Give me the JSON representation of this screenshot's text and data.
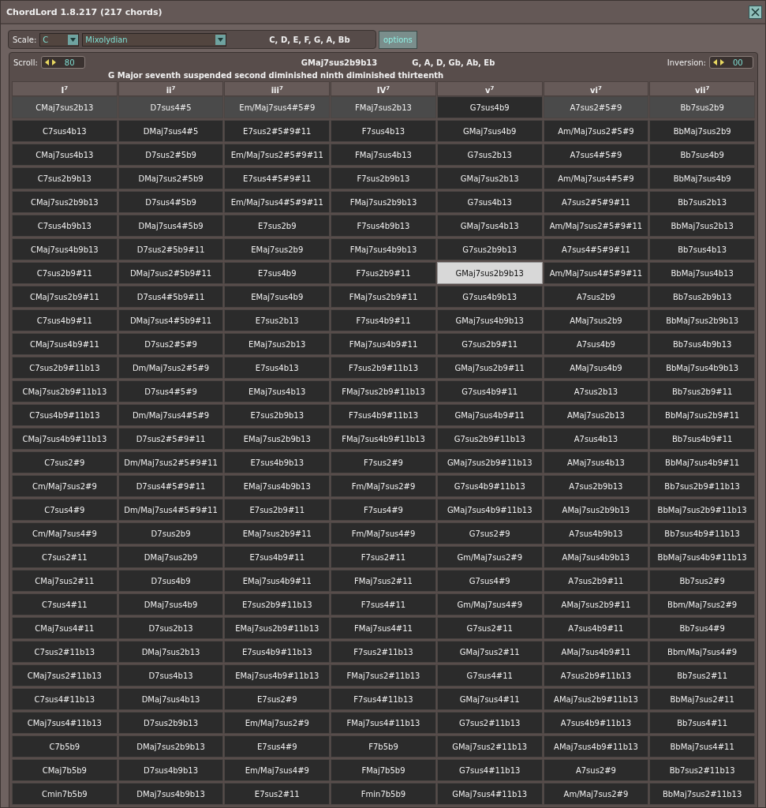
{
  "window": {
    "title": "ChordLord 1.8.217 (217 chords)"
  },
  "scale_bar": {
    "scale_label": "Scale:",
    "key": "C",
    "mode": "Mixolydian",
    "notes": "C, D, E, F, G, A, Bb",
    "options_button": "options"
  },
  "chord_bar": {
    "scroll_label": "Scroll:",
    "scroll_value": "80",
    "chord": "GMaj7sus2b9b13",
    "chord_notes": "G, A, D, Gb, Ab, Eb",
    "inversion_label": "Inversion:",
    "inversion_value": "00",
    "description": "G Major seventh suspended second diminished ninth diminished thirteenth"
  },
  "grid": {
    "columns": [
      "I$^{7}$",
      "ii$^{7}$",
      "iii$^{7}$",
      "IV$^{7}$",
      "v$^{7}$",
      "vi$^{7}$",
      "vii$^{7}$"
    ],
    "rows": [
      {
        "cells": [
          {
            "label": "CMaj7sus2b13",
            "highlighted": true,
            "selected": false
          },
          {
            "label": "D7sus4#5",
            "highlighted": true,
            "selected": false
          },
          {
            "label": "Em/Maj7sus4#5#9",
            "highlighted": true,
            "selected": false
          },
          {
            "label": "FMaj7sus2b13",
            "highlighted": true,
            "selected": false
          },
          {
            "label": "G7sus4b9",
            "highlighted": false,
            "selected": false
          },
          {
            "label": "A7sus2#5#9",
            "highlighted": true,
            "selected": false
          },
          {
            "label": "Bb7sus2b9",
            "highlighted": true,
            "selected": false
          }
        ]
      },
      {
        "cells": [
          {
            "label": "C7sus4b13",
            "highlighted": false,
            "selected": false
          },
          {
            "label": "DMaj7sus4#5",
            "highlighted": false,
            "selected": false
          },
          {
            "label": "E7sus2#5#9#11",
            "highlighted": false,
            "selected": false
          },
          {
            "label": "F7sus4b13",
            "highlighted": false,
            "selected": false
          },
          {
            "label": "GMaj7sus4b9",
            "highlighted": false,
            "selected": false
          },
          {
            "label": "Am/Maj7sus2#5#9",
            "highlighted": false,
            "selected": false
          },
          {
            "label": "BbMaj7sus2b9",
            "highlighted": false,
            "selected": false
          }
        ]
      },
      {
        "cells": [
          {
            "label": "CMaj7sus4b13",
            "highlighted": false,
            "selected": false
          },
          {
            "label": "D7sus2#5b9",
            "highlighted": false,
            "selected": false
          },
          {
            "label": "Em/Maj7sus2#5#9#11",
            "highlighted": false,
            "selected": false
          },
          {
            "label": "FMaj7sus4b13",
            "highlighted": false,
            "selected": false
          },
          {
            "label": "G7sus2b13",
            "highlighted": false,
            "selected": false
          },
          {
            "label": "A7sus4#5#9",
            "highlighted": false,
            "selected": false
          },
          {
            "label": "Bb7sus4b9",
            "highlighted": false,
            "selected": false
          }
        ]
      },
      {
        "cells": [
          {
            "label": "C7sus2b9b13",
            "highlighted": false,
            "selected": false
          },
          {
            "label": "DMaj7sus2#5b9",
            "highlighted": false,
            "selected": false
          },
          {
            "label": "E7sus4#5#9#11",
            "highlighted": false,
            "selected": false
          },
          {
            "label": "F7sus2b9b13",
            "highlighted": false,
            "selected": false
          },
          {
            "label": "GMaj7sus2b13",
            "highlighted": false,
            "selected": false
          },
          {
            "label": "Am/Maj7sus4#5#9",
            "highlighted": false,
            "selected": false
          },
          {
            "label": "BbMaj7sus4b9",
            "highlighted": false,
            "selected": false
          }
        ]
      },
      {
        "cells": [
          {
            "label": "CMaj7sus2b9b13",
            "highlighted": false,
            "selected": false
          },
          {
            "label": "D7sus4#5b9",
            "highlighted": false,
            "selected": false
          },
          {
            "label": "Em/Maj7sus4#5#9#11",
            "highlighted": false,
            "selected": false
          },
          {
            "label": "FMaj7sus2b9b13",
            "highlighted": false,
            "selected": false
          },
          {
            "label": "G7sus4b13",
            "highlighted": false,
            "selected": false
          },
          {
            "label": "A7sus2#5#9#11",
            "highlighted": false,
            "selected": false
          },
          {
            "label": "Bb7sus2b13",
            "highlighted": false,
            "selected": false
          }
        ]
      },
      {
        "cells": [
          {
            "label": "C7sus4b9b13",
            "highlighted": false,
            "selected": false
          },
          {
            "label": "DMaj7sus4#5b9",
            "highlighted": false,
            "selected": false
          },
          {
            "label": "E7sus2b9",
            "highlighted": false,
            "selected": false
          },
          {
            "label": "F7sus4b9b13",
            "highlighted": false,
            "selected": false
          },
          {
            "label": "GMaj7sus4b13",
            "highlighted": false,
            "selected": false
          },
          {
            "label": "Am/Maj7sus2#5#9#11",
            "highlighted": false,
            "selected": false
          },
          {
            "label": "BbMaj7sus2b13",
            "highlighted": false,
            "selected": false
          }
        ]
      },
      {
        "cells": [
          {
            "label": "CMaj7sus4b9b13",
            "highlighted": false,
            "selected": false
          },
          {
            "label": "D7sus2#5b9#11",
            "highlighted": false,
            "selected": false
          },
          {
            "label": "EMaj7sus2b9",
            "highlighted": false,
            "selected": false
          },
          {
            "label": "FMaj7sus4b9b13",
            "highlighted": false,
            "selected": false
          },
          {
            "label": "G7sus2b9b13",
            "highlighted": false,
            "selected": false
          },
          {
            "label": "A7sus4#5#9#11",
            "highlighted": false,
            "selected": false
          },
          {
            "label": "Bb7sus4b13",
            "highlighted": false,
            "selected": false
          }
        ]
      },
      {
        "cells": [
          {
            "label": "C7sus2b9#11",
            "highlighted": false,
            "selected": false
          },
          {
            "label": "DMaj7sus2#5b9#11",
            "highlighted": false,
            "selected": false
          },
          {
            "label": "E7sus4b9",
            "highlighted": false,
            "selected": false
          },
          {
            "label": "F7sus2b9#11",
            "highlighted": false,
            "selected": false
          },
          {
            "label": "GMaj7sus2b9b13",
            "highlighted": false,
            "selected": true
          },
          {
            "label": "Am/Maj7sus4#5#9#11",
            "highlighted": false,
            "selected": false
          },
          {
            "label": "BbMaj7sus4b13",
            "highlighted": false,
            "selected": false
          }
        ]
      },
      {
        "cells": [
          {
            "label": "CMaj7sus2b9#11",
            "highlighted": false,
            "selected": false
          },
          {
            "label": "D7sus4#5b9#11",
            "highlighted": false,
            "selected": false
          },
          {
            "label": "EMaj7sus4b9",
            "highlighted": false,
            "selected": false
          },
          {
            "label": "FMaj7sus2b9#11",
            "highlighted": false,
            "selected": false
          },
          {
            "label": "G7sus4b9b13",
            "highlighted": false,
            "selected": false
          },
          {
            "label": "A7sus2b9",
            "highlighted": false,
            "selected": false
          },
          {
            "label": "Bb7sus2b9b13",
            "highlighted": false,
            "selected": false
          }
        ]
      },
      {
        "cells": [
          {
            "label": "C7sus4b9#11",
            "highlighted": false,
            "selected": false
          },
          {
            "label": "DMaj7sus4#5b9#11",
            "highlighted": false,
            "selected": false
          },
          {
            "label": "E7sus2b13",
            "highlighted": false,
            "selected": false
          },
          {
            "label": "F7sus4b9#11",
            "highlighted": false,
            "selected": false
          },
          {
            "label": "GMaj7sus4b9b13",
            "highlighted": false,
            "selected": false
          },
          {
            "label": "AMaj7sus2b9",
            "highlighted": false,
            "selected": false
          },
          {
            "label": "BbMaj7sus2b9b13",
            "highlighted": false,
            "selected": false
          }
        ]
      },
      {
        "cells": [
          {
            "label": "CMaj7sus4b9#11",
            "highlighted": false,
            "selected": false
          },
          {
            "label": "D7sus2#5#9",
            "highlighted": false,
            "selected": false
          },
          {
            "label": "EMaj7sus2b13",
            "highlighted": false,
            "selected": false
          },
          {
            "label": "FMaj7sus4b9#11",
            "highlighted": false,
            "selected": false
          },
          {
            "label": "G7sus2b9#11",
            "highlighted": false,
            "selected": false
          },
          {
            "label": "A7sus4b9",
            "highlighted": false,
            "selected": false
          },
          {
            "label": "Bb7sus4b9b13",
            "highlighted": false,
            "selected": false
          }
        ]
      },
      {
        "cells": [
          {
            "label": "C7sus2b9#11b13",
            "highlighted": false,
            "selected": false
          },
          {
            "label": "Dm/Maj7sus2#5#9",
            "highlighted": false,
            "selected": false
          },
          {
            "label": "E7sus4b13",
            "highlighted": false,
            "selected": false
          },
          {
            "label": "F7sus2b9#11b13",
            "highlighted": false,
            "selected": false
          },
          {
            "label": "GMaj7sus2b9#11",
            "highlighted": false,
            "selected": false
          },
          {
            "label": "AMaj7sus4b9",
            "highlighted": false,
            "selected": false
          },
          {
            "label": "BbMaj7sus4b9b13",
            "highlighted": false,
            "selected": false
          }
        ]
      },
      {
        "cells": [
          {
            "label": "CMaj7sus2b9#11b13",
            "highlighted": false,
            "selected": false
          },
          {
            "label": "D7sus4#5#9",
            "highlighted": false,
            "selected": false
          },
          {
            "label": "EMaj7sus4b13",
            "highlighted": false,
            "selected": false
          },
          {
            "label": "FMaj7sus2b9#11b13",
            "highlighted": false,
            "selected": false
          },
          {
            "label": "G7sus4b9#11",
            "highlighted": false,
            "selected": false
          },
          {
            "label": "A7sus2b13",
            "highlighted": false,
            "selected": false
          },
          {
            "label": "Bb7sus2b9#11",
            "highlighted": false,
            "selected": false
          }
        ]
      },
      {
        "cells": [
          {
            "label": "C7sus4b9#11b13",
            "highlighted": false,
            "selected": false
          },
          {
            "label": "Dm/Maj7sus4#5#9",
            "highlighted": false,
            "selected": false
          },
          {
            "label": "E7sus2b9b13",
            "highlighted": false,
            "selected": false
          },
          {
            "label": "F7sus4b9#11b13",
            "highlighted": false,
            "selected": false
          },
          {
            "label": "GMaj7sus4b9#11",
            "highlighted": false,
            "selected": false
          },
          {
            "label": "AMaj7sus2b13",
            "highlighted": false,
            "selected": false
          },
          {
            "label": "BbMaj7sus2b9#11",
            "highlighted": false,
            "selected": false
          }
        ]
      },
      {
        "cells": [
          {
            "label": "CMaj7sus4b9#11b13",
            "highlighted": false,
            "selected": false
          },
          {
            "label": "D7sus2#5#9#11",
            "highlighted": false,
            "selected": false
          },
          {
            "label": "EMaj7sus2b9b13",
            "highlighted": false,
            "selected": false
          },
          {
            "label": "FMaj7sus4b9#11b13",
            "highlighted": false,
            "selected": false
          },
          {
            "label": "G7sus2b9#11b13",
            "highlighted": false,
            "selected": false
          },
          {
            "label": "A7sus4b13",
            "highlighted": false,
            "selected": false
          },
          {
            "label": "Bb7sus4b9#11",
            "highlighted": false,
            "selected": false
          }
        ]
      },
      {
        "cells": [
          {
            "label": "C7sus2#9",
            "highlighted": false,
            "selected": false
          },
          {
            "label": "Dm/Maj7sus2#5#9#11",
            "highlighted": false,
            "selected": false
          },
          {
            "label": "E7sus4b9b13",
            "highlighted": false,
            "selected": false
          },
          {
            "label": "F7sus2#9",
            "highlighted": false,
            "selected": false
          },
          {
            "label": "GMaj7sus2b9#11b13",
            "highlighted": false,
            "selected": false
          },
          {
            "label": "AMaj7sus4b13",
            "highlighted": false,
            "selected": false
          },
          {
            "label": "BbMaj7sus4b9#11",
            "highlighted": false,
            "selected": false
          }
        ]
      },
      {
        "cells": [
          {
            "label": "Cm/Maj7sus2#9",
            "highlighted": false,
            "selected": false
          },
          {
            "label": "D7sus4#5#9#11",
            "highlighted": false,
            "selected": false
          },
          {
            "label": "EMaj7sus4b9b13",
            "highlighted": false,
            "selected": false
          },
          {
            "label": "Fm/Maj7sus2#9",
            "highlighted": false,
            "selected": false
          },
          {
            "label": "G7sus4b9#11b13",
            "highlighted": false,
            "selected": false
          },
          {
            "label": "A7sus2b9b13",
            "highlighted": false,
            "selected": false
          },
          {
            "label": "Bb7sus2b9#11b13",
            "highlighted": false,
            "selected": false
          }
        ]
      },
      {
        "cells": [
          {
            "label": "C7sus4#9",
            "highlighted": false,
            "selected": false
          },
          {
            "label": "Dm/Maj7sus4#5#9#11",
            "highlighted": false,
            "selected": false
          },
          {
            "label": "E7sus2b9#11",
            "highlighted": false,
            "selected": false
          },
          {
            "label": "F7sus4#9",
            "highlighted": false,
            "selected": false
          },
          {
            "label": "GMaj7sus4b9#11b13",
            "highlighted": false,
            "selected": false
          },
          {
            "label": "AMaj7sus2b9b13",
            "highlighted": false,
            "selected": false
          },
          {
            "label": "BbMaj7sus2b9#11b13",
            "highlighted": false,
            "selected": false
          }
        ]
      },
      {
        "cells": [
          {
            "label": "Cm/Maj7sus4#9",
            "highlighted": false,
            "selected": false
          },
          {
            "label": "D7sus2b9",
            "highlighted": false,
            "selected": false
          },
          {
            "label": "EMaj7sus2b9#11",
            "highlighted": false,
            "selected": false
          },
          {
            "label": "Fm/Maj7sus4#9",
            "highlighted": false,
            "selected": false
          },
          {
            "label": "G7sus2#9",
            "highlighted": false,
            "selected": false
          },
          {
            "label": "A7sus4b9b13",
            "highlighted": false,
            "selected": false
          },
          {
            "label": "Bb7sus4b9#11b13",
            "highlighted": false,
            "selected": false
          }
        ]
      },
      {
        "cells": [
          {
            "label": "C7sus2#11",
            "highlighted": false,
            "selected": false
          },
          {
            "label": "DMaj7sus2b9",
            "highlighted": false,
            "selected": false
          },
          {
            "label": "E7sus4b9#11",
            "highlighted": false,
            "selected": false
          },
          {
            "label": "F7sus2#11",
            "highlighted": false,
            "selected": false
          },
          {
            "label": "Gm/Maj7sus2#9",
            "highlighted": false,
            "selected": false
          },
          {
            "label": "AMaj7sus4b9b13",
            "highlighted": false,
            "selected": false
          },
          {
            "label": "BbMaj7sus4b9#11b13",
            "highlighted": false,
            "selected": false
          }
        ]
      },
      {
        "cells": [
          {
            "label": "CMaj7sus2#11",
            "highlighted": false,
            "selected": false
          },
          {
            "label": "D7sus4b9",
            "highlighted": false,
            "selected": false
          },
          {
            "label": "EMaj7sus4b9#11",
            "highlighted": false,
            "selected": false
          },
          {
            "label": "FMaj7sus2#11",
            "highlighted": false,
            "selected": false
          },
          {
            "label": "G7sus4#9",
            "highlighted": false,
            "selected": false
          },
          {
            "label": "A7sus2b9#11",
            "highlighted": false,
            "selected": false
          },
          {
            "label": "Bb7sus2#9",
            "highlighted": false,
            "selected": false
          }
        ]
      },
      {
        "cells": [
          {
            "label": "C7sus4#11",
            "highlighted": false,
            "selected": false
          },
          {
            "label": "DMaj7sus4b9",
            "highlighted": false,
            "selected": false
          },
          {
            "label": "E7sus2b9#11b13",
            "highlighted": false,
            "selected": false
          },
          {
            "label": "F7sus4#11",
            "highlighted": false,
            "selected": false
          },
          {
            "label": "Gm/Maj7sus4#9",
            "highlighted": false,
            "selected": false
          },
          {
            "label": "AMaj7sus2b9#11",
            "highlighted": false,
            "selected": false
          },
          {
            "label": "Bbm/Maj7sus2#9",
            "highlighted": false,
            "selected": false
          }
        ]
      },
      {
        "cells": [
          {
            "label": "CMaj7sus4#11",
            "highlighted": false,
            "selected": false
          },
          {
            "label": "D7sus2b13",
            "highlighted": false,
            "selected": false
          },
          {
            "label": "EMaj7sus2b9#11b13",
            "highlighted": false,
            "selected": false
          },
          {
            "label": "FMaj7sus4#11",
            "highlighted": false,
            "selected": false
          },
          {
            "label": "G7sus2#11",
            "highlighted": false,
            "selected": false
          },
          {
            "label": "A7sus4b9#11",
            "highlighted": false,
            "selected": false
          },
          {
            "label": "Bb7sus4#9",
            "highlighted": false,
            "selected": false
          }
        ]
      },
      {
        "cells": [
          {
            "label": "C7sus2#11b13",
            "highlighted": false,
            "selected": false
          },
          {
            "label": "DMaj7sus2b13",
            "highlighted": false,
            "selected": false
          },
          {
            "label": "E7sus4b9#11b13",
            "highlighted": false,
            "selected": false
          },
          {
            "label": "F7sus2#11b13",
            "highlighted": false,
            "selected": false
          },
          {
            "label": "GMaj7sus2#11",
            "highlighted": false,
            "selected": false
          },
          {
            "label": "AMaj7sus4b9#11",
            "highlighted": false,
            "selected": false
          },
          {
            "label": "Bbm/Maj7sus4#9",
            "highlighted": false,
            "selected": false
          }
        ]
      },
      {
        "cells": [
          {
            "label": "CMaj7sus2#11b13",
            "highlighted": false,
            "selected": false
          },
          {
            "label": "D7sus4b13",
            "highlighted": false,
            "selected": false
          },
          {
            "label": "EMaj7sus4b9#11b13",
            "highlighted": false,
            "selected": false
          },
          {
            "label": "FMaj7sus2#11b13",
            "highlighted": false,
            "selected": false
          },
          {
            "label": "G7sus4#11",
            "highlighted": false,
            "selected": false
          },
          {
            "label": "A7sus2b9#11b13",
            "highlighted": false,
            "selected": false
          },
          {
            "label": "Bb7sus2#11",
            "highlighted": false,
            "selected": false
          }
        ]
      },
      {
        "cells": [
          {
            "label": "C7sus4#11b13",
            "highlighted": false,
            "selected": false
          },
          {
            "label": "DMaj7sus4b13",
            "highlighted": false,
            "selected": false
          },
          {
            "label": "E7sus2#9",
            "highlighted": false,
            "selected": false
          },
          {
            "label": "F7sus4#11b13",
            "highlighted": false,
            "selected": false
          },
          {
            "label": "GMaj7sus4#11",
            "highlighted": false,
            "selected": false
          },
          {
            "label": "AMaj7sus2b9#11b13",
            "highlighted": false,
            "selected": false
          },
          {
            "label": "BbMaj7sus2#11",
            "highlighted": false,
            "selected": false
          }
        ]
      },
      {
        "cells": [
          {
            "label": "CMaj7sus4#11b13",
            "highlighted": false,
            "selected": false
          },
          {
            "label": "D7sus2b9b13",
            "highlighted": false,
            "selected": false
          },
          {
            "label": "Em/Maj7sus2#9",
            "highlighted": false,
            "selected": false
          },
          {
            "label": "FMaj7sus4#11b13",
            "highlighted": false,
            "selected": false
          },
          {
            "label": "G7sus2#11b13",
            "highlighted": false,
            "selected": false
          },
          {
            "label": "A7sus4b9#11b13",
            "highlighted": false,
            "selected": false
          },
          {
            "label": "Bb7sus4#11",
            "highlighted": false,
            "selected": false
          }
        ]
      },
      {
        "cells": [
          {
            "label": "C7b5b9",
            "highlighted": false,
            "selected": false
          },
          {
            "label": "DMaj7sus2b9b13",
            "highlighted": false,
            "selected": false
          },
          {
            "label": "E7sus4#9",
            "highlighted": false,
            "selected": false
          },
          {
            "label": "F7b5b9",
            "highlighted": false,
            "selected": false
          },
          {
            "label": "GMaj7sus2#11b13",
            "highlighted": false,
            "selected": false
          },
          {
            "label": "AMaj7sus4b9#11b13",
            "highlighted": false,
            "selected": false
          },
          {
            "label": "BbMaj7sus4#11",
            "highlighted": false,
            "selected": false
          }
        ]
      },
      {
        "cells": [
          {
            "label": "CMaj7b5b9",
            "highlighted": false,
            "selected": false
          },
          {
            "label": "D7sus4b9b13",
            "highlighted": false,
            "selected": false
          },
          {
            "label": "Em/Maj7sus4#9",
            "highlighted": false,
            "selected": false
          },
          {
            "label": "FMaj7b5b9",
            "highlighted": false,
            "selected": false
          },
          {
            "label": "G7sus4#11b13",
            "highlighted": false,
            "selected": false
          },
          {
            "label": "A7sus2#9",
            "highlighted": false,
            "selected": false
          },
          {
            "label": "Bb7sus2#11b13",
            "highlighted": false,
            "selected": false
          }
        ]
      },
      {
        "cells": [
          {
            "label": "Cmin7b5b9",
            "highlighted": false,
            "selected": false
          },
          {
            "label": "DMaj7sus4b9b13",
            "highlighted": false,
            "selected": false
          },
          {
            "label": "E7sus2#11",
            "highlighted": false,
            "selected": false
          },
          {
            "label": "Fmin7b5b9",
            "highlighted": false,
            "selected": false
          },
          {
            "label": "GMaj7sus4#11b13",
            "highlighted": false,
            "selected": false
          },
          {
            "label": "Am/Maj7sus2#9",
            "highlighted": false,
            "selected": false
          },
          {
            "label": "BbMaj7sus2#11b13",
            "highlighted": false,
            "selected": false
          }
        ]
      }
    ]
  }
}
